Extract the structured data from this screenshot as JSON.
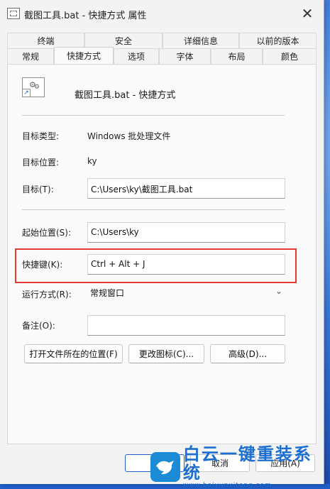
{
  "window": {
    "title": "截图工具.bat - 快捷方式 属性",
    "close_glyph": "✕"
  },
  "tabs": {
    "back": [
      "终端",
      "安全",
      "详细信息",
      "以前的版本"
    ],
    "front": [
      "常规",
      "快捷方式",
      "选项",
      "字体",
      "布局",
      "颜色"
    ],
    "active": "快捷方式"
  },
  "shortcut": {
    "name": "截图工具.bat - 快捷方式",
    "target_type_label": "目标类型:",
    "target_type_value": "Windows 批处理文件",
    "target_location_label": "目标位置:",
    "target_location_value": "ky",
    "target_label": "目标(T):",
    "target_value": "C:\\Users\\ky\\截图工具.bat",
    "start_in_label": "起始位置(S):",
    "start_in_value": "C:\\Users\\ky",
    "hotkey_label": "快捷键(K):",
    "hotkey_value": "Ctrl + Alt + J",
    "run_label": "运行方式(R):",
    "run_value": "常规窗口",
    "comment_label": "备注(O):",
    "comment_value": ""
  },
  "buttons": {
    "open_location": "打开文件所在的位置(F)",
    "change_icon": "更改图标(C)...",
    "advanced": "高级(D)..."
  },
  "footer": {
    "ok_visible": "确",
    "cancel_visible": "取消",
    "apply_visible": "应用(A)"
  },
  "watermark": {
    "brand": "白云一键重装系统",
    "url": "www.baiyunxitong.com"
  },
  "colors": {
    "highlight": "#e53935",
    "accent": "#1f63c9"
  }
}
